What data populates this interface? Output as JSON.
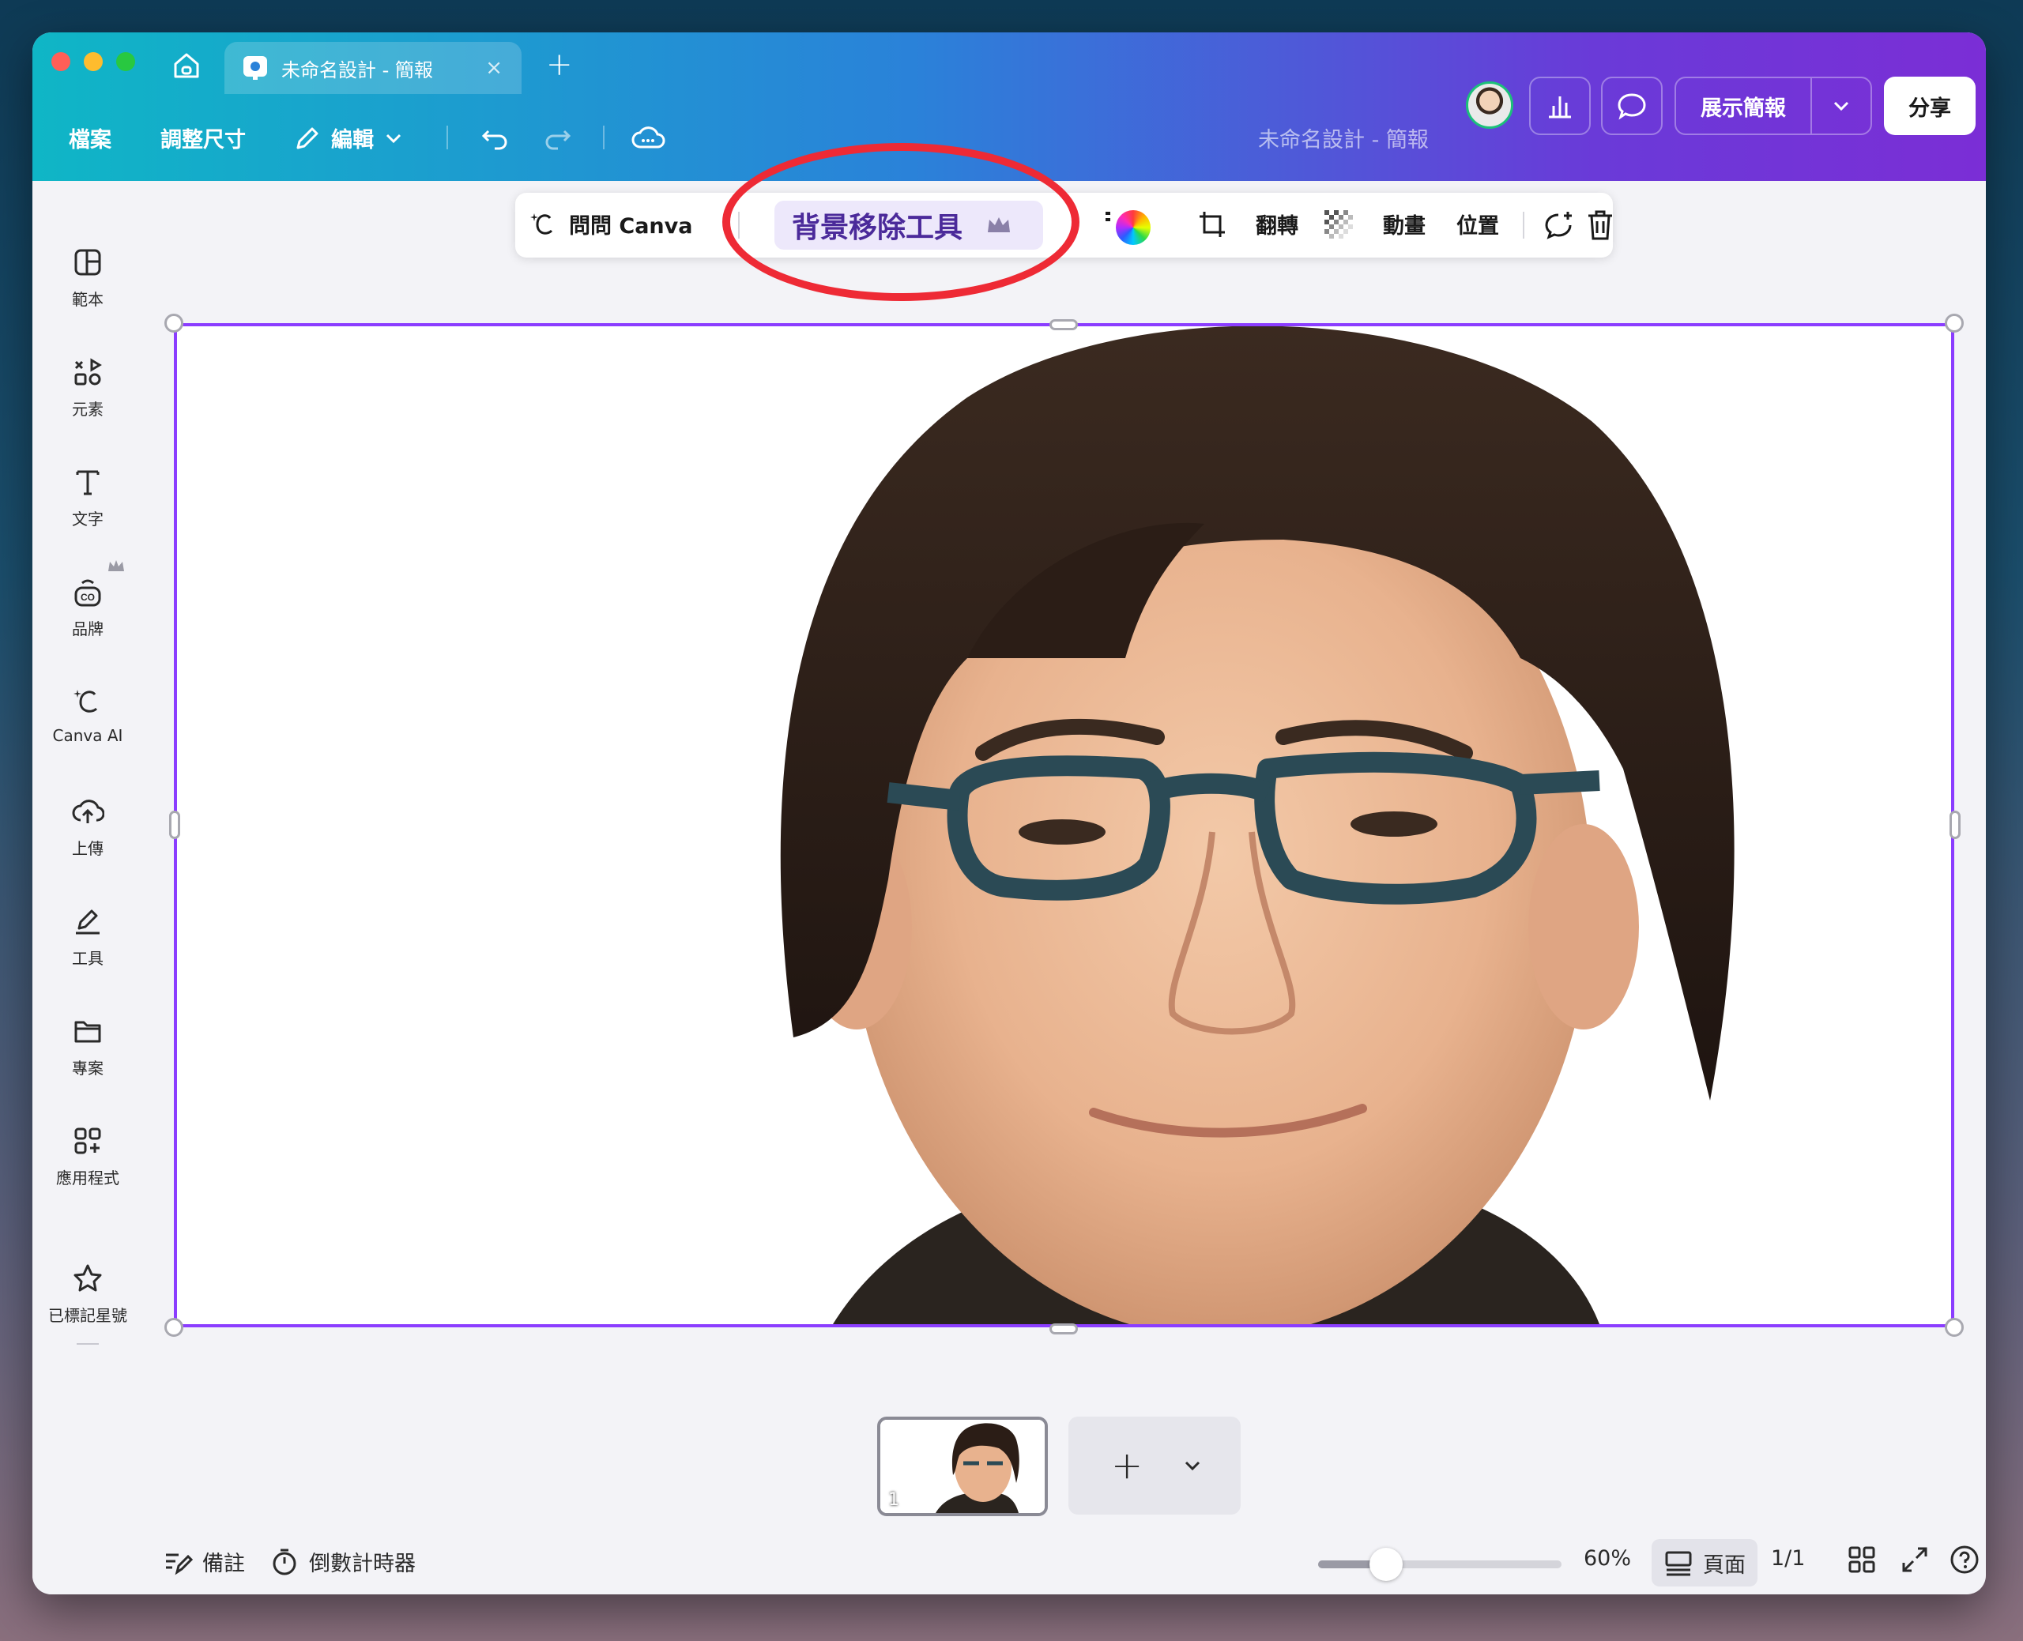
{
  "tab": {
    "title": "未命名設計 - 簡報",
    "close": "×",
    "new_tab": "+"
  },
  "menu": {
    "file": "檔案",
    "resize": "調整尺寸",
    "edit": "編輯",
    "doc_title": "未命名設計 - 簡報",
    "present": "展示簡報",
    "share": "分享"
  },
  "sidebar": {
    "items": [
      {
        "label": "範本",
        "icon": "template-icon"
      },
      {
        "label": "元素",
        "icon": "elements-icon"
      },
      {
        "label": "文字",
        "icon": "text-icon"
      },
      {
        "label": "品牌",
        "icon": "brand-icon"
      },
      {
        "label": "Canva AI",
        "icon": "canva-ai-icon"
      },
      {
        "label": "上傳",
        "icon": "upload-icon"
      },
      {
        "label": "工具",
        "icon": "tools-icon"
      },
      {
        "label": "專案",
        "icon": "projects-icon"
      },
      {
        "label": "應用程式",
        "icon": "apps-icon"
      },
      {
        "label": "已標記星號",
        "icon": "star-icon"
      }
    ]
  },
  "toolbar": {
    "ask_canva": "問問 Canva",
    "bg_remover": "背景移除工具",
    "flip": "翻轉",
    "animate": "動畫",
    "position": "位置"
  },
  "pages": {
    "thumb_number": "1",
    "add": "+"
  },
  "bottom": {
    "notes": "備註",
    "timer": "倒數計時器",
    "zoom": "60%",
    "zoom_fraction": 0.28,
    "page_view": "頁面",
    "page_count": "1/1"
  },
  "colors": {
    "accent": "#8b3dff",
    "annotation": "#ee2a35",
    "header_start": "#0fb6c6",
    "header_end": "#7b2ed6"
  }
}
